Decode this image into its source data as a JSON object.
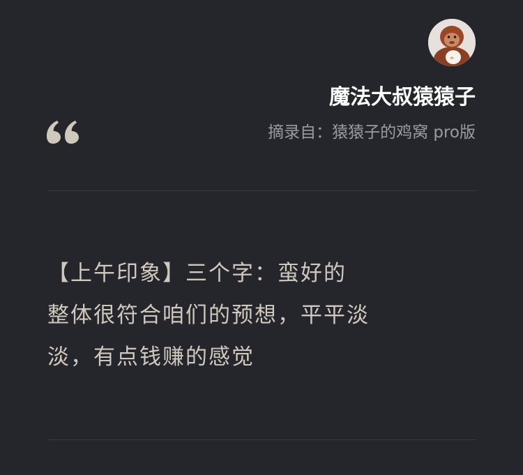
{
  "author": {
    "name": "魔法大叔猿猿子"
  },
  "source": {
    "label": "摘录自：",
    "title": "猿猿子的鸡窝 pro版"
  },
  "excerpt": {
    "lines": [
      "【上午印象】三个字：蛮好的",
      "整体很符合咱们的预想，平平淡",
      "淡，有点钱赚的感觉"
    ]
  },
  "icons": {
    "quote": "quote-mark-icon",
    "avatar": "orangutan-plush-avatar"
  },
  "colors": {
    "background": "#25262b",
    "author_text": "#ffffff",
    "source_text": "#9a9ca3",
    "excerpt_text": "#cfc8bd",
    "quote_mark": "#cfc8bd",
    "divider": "#3c3d43"
  }
}
